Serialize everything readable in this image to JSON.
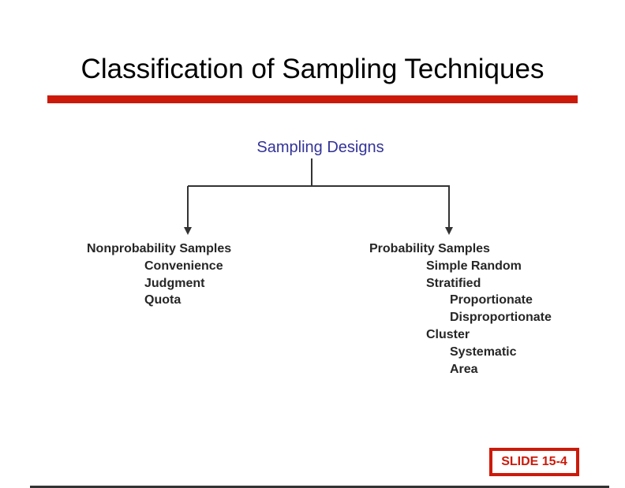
{
  "title": "Classification of Sampling Techniques",
  "colors": {
    "accent_red": "#cc1a0a",
    "root_text": "#333399",
    "body_text": "#262626",
    "connector": "#333333"
  },
  "diagram": {
    "root": "Sampling Designs",
    "branches": [
      {
        "label": "Nonprobability Samples",
        "children": [
          {
            "label": "Convenience",
            "children": []
          },
          {
            "label": "Judgment",
            "children": []
          },
          {
            "label": "Quota",
            "children": []
          }
        ]
      },
      {
        "label": "Probability Samples",
        "children": [
          {
            "label": "Simple Random",
            "children": []
          },
          {
            "label": "Stratified",
            "children": [
              {
                "label": "Proportionate"
              },
              {
                "label": "Disproportionate"
              }
            ]
          },
          {
            "label": "Cluster",
            "children": [
              {
                "label": "Systematic"
              },
              {
                "label": "Area"
              }
            ]
          }
        ]
      }
    ]
  },
  "footer": {
    "slide_label": "SLIDE 15-4"
  }
}
